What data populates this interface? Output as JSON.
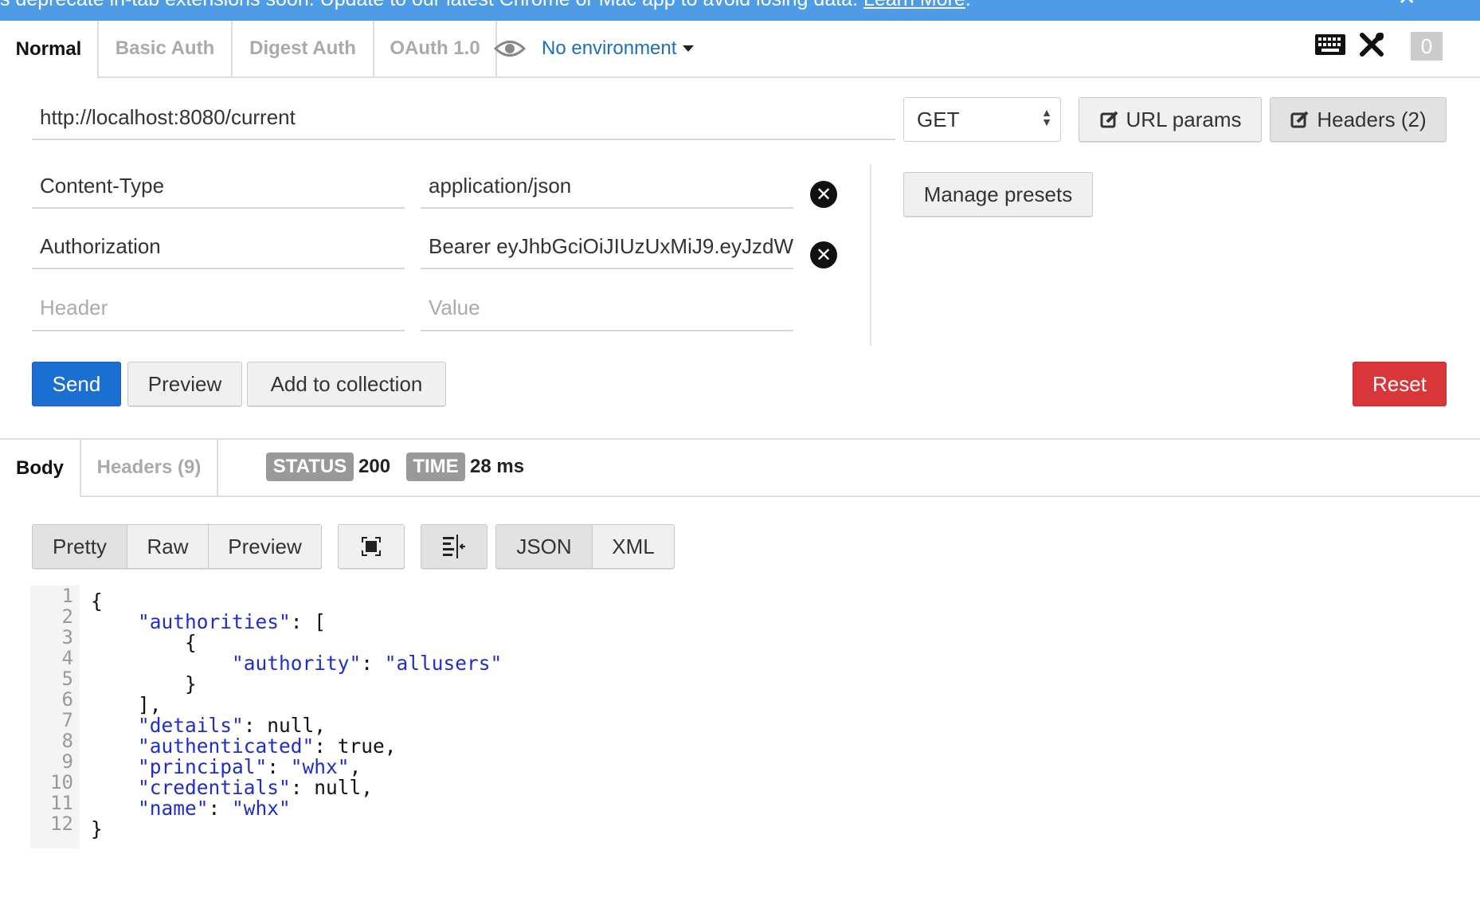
{
  "banner": {
    "text": "s deprecate in-tab extensions soon. Update to our latest Chrome or Mac app to avoid losing data. ",
    "link": "Learn More",
    "close": "✕"
  },
  "auth_tabs": [
    "Normal",
    "Basic Auth",
    "Digest Auth",
    "OAuth 1.0"
  ],
  "environment": {
    "label": "No environment"
  },
  "toolbar": {
    "counter": "0"
  },
  "request": {
    "url": "http://localhost:8080/current",
    "method": "GET",
    "url_params_label": "URL params",
    "headers_label": "Headers (2)",
    "manage_presets_label": "Manage presets"
  },
  "headers": [
    {
      "key": "Content-Type",
      "value": "application/json"
    },
    {
      "key": "Authorization",
      "value": "Bearer eyJhbGciOiJIUzUxMiJ9.eyJzdW"
    }
  ],
  "new_header": {
    "key_placeholder": "Header",
    "value_placeholder": "Value"
  },
  "actions": {
    "send": "Send",
    "preview": "Preview",
    "add_to_collection": "Add to collection",
    "reset": "Reset"
  },
  "response": {
    "tabs": [
      "Body",
      "Headers (9)"
    ],
    "status_label": "STATUS",
    "status_value": "200",
    "time_label": "TIME",
    "time_value": "28 ms",
    "view_modes": [
      "Pretty",
      "Raw",
      "Preview"
    ],
    "formats": [
      "JSON",
      "XML"
    ]
  },
  "body_lines": [
    "{",
    "    \"authorities\": [",
    "        {",
    "            \"authority\": \"allusers\"",
    "        }",
    "    ],",
    "    \"details\": null,",
    "    \"authenticated\": true,",
    "    \"principal\": \"whx\",",
    "    \"credentials\": null,",
    "    \"name\": \"whx\"",
    "}"
  ],
  "colors": {
    "send": "#1a6fd0",
    "reset": "#d9363a",
    "link": "#1a6fb8",
    "json": "#1f2ec8"
  }
}
